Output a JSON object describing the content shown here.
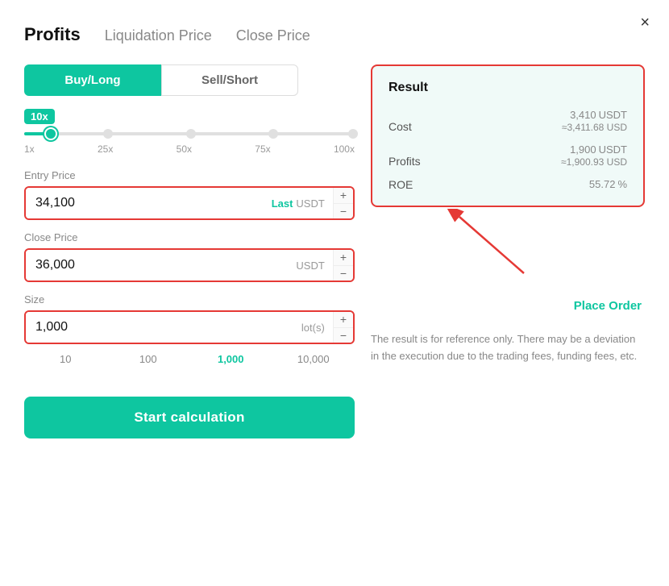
{
  "modal": {
    "close_label": "×"
  },
  "tabs": [
    {
      "id": "profits",
      "label": "Profits",
      "active": true
    },
    {
      "id": "liquidation",
      "label": "Liquidation Price",
      "active": false
    },
    {
      "id": "close",
      "label": "Close Price",
      "active": false
    }
  ],
  "toggle": {
    "buy_label": "Buy/Long",
    "sell_label": "Sell/Short"
  },
  "leverage": {
    "badge": "10x",
    "marks": [
      "1x",
      "25x",
      "50x",
      "75x",
      "100x"
    ]
  },
  "entry_price": {
    "label": "Entry Price",
    "value": "34,100",
    "suffix_last": "Last",
    "suffix_unit": "USDT",
    "plus": "+",
    "minus": "−"
  },
  "close_price": {
    "label": "Close Price",
    "value": "36,000",
    "suffix_unit": "USDT",
    "plus": "+",
    "minus": "−"
  },
  "size": {
    "label": "Size",
    "value": "1,000",
    "suffix_unit": "lot(s)",
    "plus": "+",
    "minus": "−",
    "presets": [
      "10",
      "100",
      "1,000",
      "10,000"
    ]
  },
  "calc_button": "Start calculation",
  "result": {
    "title": "Result",
    "cost_label": "Cost",
    "cost_main": "3,410",
    "cost_unit": "USDT",
    "cost_sub": "≈3,411.68 USD",
    "profits_label": "Profits",
    "profits_main": "1,900",
    "profits_unit": "USDT",
    "profits_sub": "≈1,900.93 USD",
    "roe_label": "ROE",
    "roe_main": "55.72",
    "roe_unit": "%",
    "place_order": "Place Order"
  },
  "disclaimer": "The result is for reference only. There may be a deviation in the execution due to the trading fees, funding fees, etc."
}
